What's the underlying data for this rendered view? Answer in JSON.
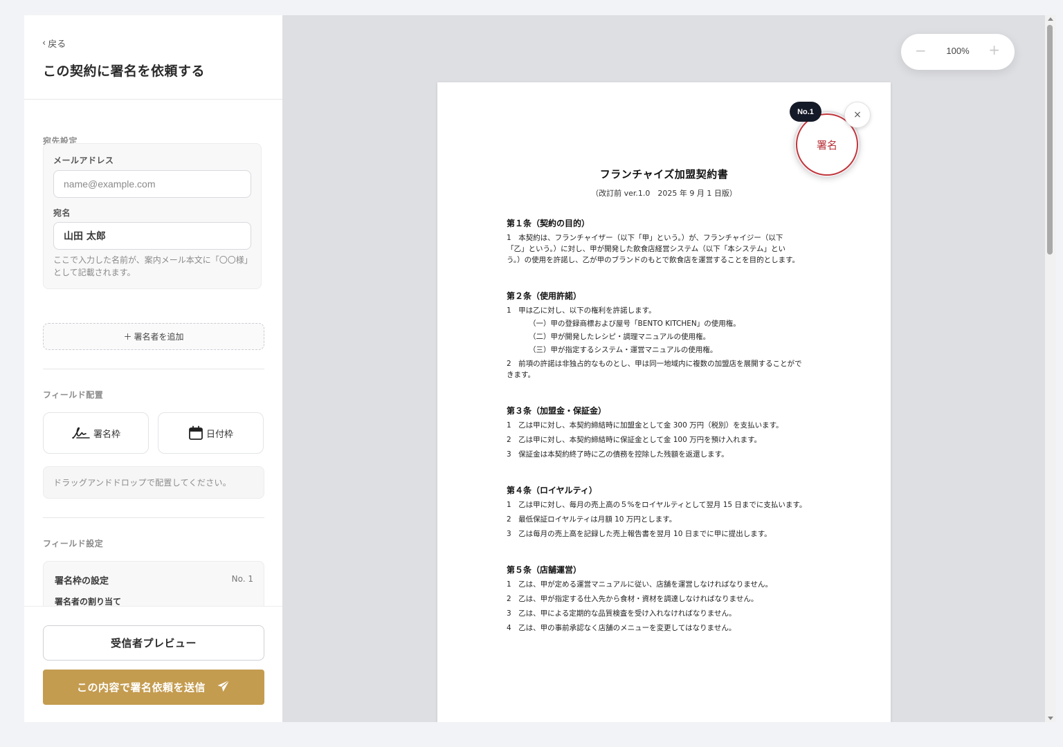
{
  "sidebar": {
    "back_label": "戻る",
    "title": "この契約に署名を依頼する",
    "recipient_section": "宛先設定",
    "email_label": "メールアドレス",
    "email_placeholder": "name@example.com",
    "name_label": "宛名",
    "name_value": "山田 太郎",
    "name_hint": "ここで入力した名前が、案内メール本文に「〇〇様」として記載されます。",
    "add_signer_label": "署名者を追加",
    "field_section": "フィールド配置",
    "signature_tool_label": "署名枠",
    "date_tool_label": "日付枠",
    "drop_hint": "ドラッグアンドドロップで配置してください。",
    "field_settings_section": "フィールド設定",
    "settings_title": "署名枠の設定",
    "settings_no": "No. 1",
    "assign_label": "署名者の割り当て",
    "preview_button": "受信者プレビュー",
    "send_button": "この内容で署名依頼を送信",
    "accent_color": "#c49c50"
  },
  "viewer": {
    "zoom_level": "100%",
    "zoom_minus": "−",
    "zoom_plus": "+",
    "signature_badge": "No.1",
    "signature_text": "署名",
    "close_symbol": "×"
  },
  "document": {
    "title": "フランチャイズ加盟契約書",
    "subtitle": "（改訂前 ver.1.0　2025 年 9 月 1 日版）",
    "articles": [
      {
        "title": "第１条（契約の目的）",
        "lines": [
          "1　本契約は、フランチャイザー（以下「甲」という。）が、フランチャイジー（以下",
          "「乙」という。）に対し、甲が開発した飲食店経営システム（以下「本システム」とい",
          "う。）の使用を許諾し、乙が甲のブランドのもとで飲食店を運営することを目的とします。"
        ]
      },
      {
        "title": "第２条（使用許諾）",
        "lines": [
          "1　甲は乙に対し、以下の権利を許諾します。",
          "（一）甲の登録商標および屋号「BENTO KITCHEN」の使用権。",
          "（二）甲が開発したレシピ・調理マニュアルの使用権。",
          "（三）甲が指定するシステム・運営マニュアルの使用権。",
          "2　前項の許諾は非独占的なものとし、甲は同一地域内に複数の加盟店を展開することがで",
          "きます。"
        ]
      },
      {
        "title": "第３条（加盟金・保証金）",
        "lines": [
          "1　乙は甲に対し、本契約締結時に加盟金として金 300 万円（税別）を支払います。",
          "2　乙は甲に対し、本契約締結時に保証金として金 100 万円を預け入れます。",
          "3　保証金は本契約終了時に乙の債務を控除した残額を返還します。"
        ]
      },
      {
        "title": "第４条（ロイヤルティ）",
        "lines": [
          "1　乙は甲に対し、毎月の売上高の５%をロイヤルティとして翌月 15 日までに支払います。",
          "2　最低保証ロイヤルティは月額 10 万円とします。",
          "3　乙は毎月の売上高を記録した売上報告書を翌月 10 日までに甲に提出します。"
        ]
      },
      {
        "title": "第５条（店舗運営）",
        "lines": [
          "1　乙は、甲が定める運営マニュアルに従い、店舗を運営しなければなりません。",
          "2　乙は、甲が指定する仕入先から食材・資材を調達しなければなりません。",
          "3　乙は、甲による定期的な品質検査を受け入れなければなりません。",
          "4　乙は、甲の事前承認なく店舗のメニューを変更してはなりません。"
        ]
      }
    ]
  }
}
